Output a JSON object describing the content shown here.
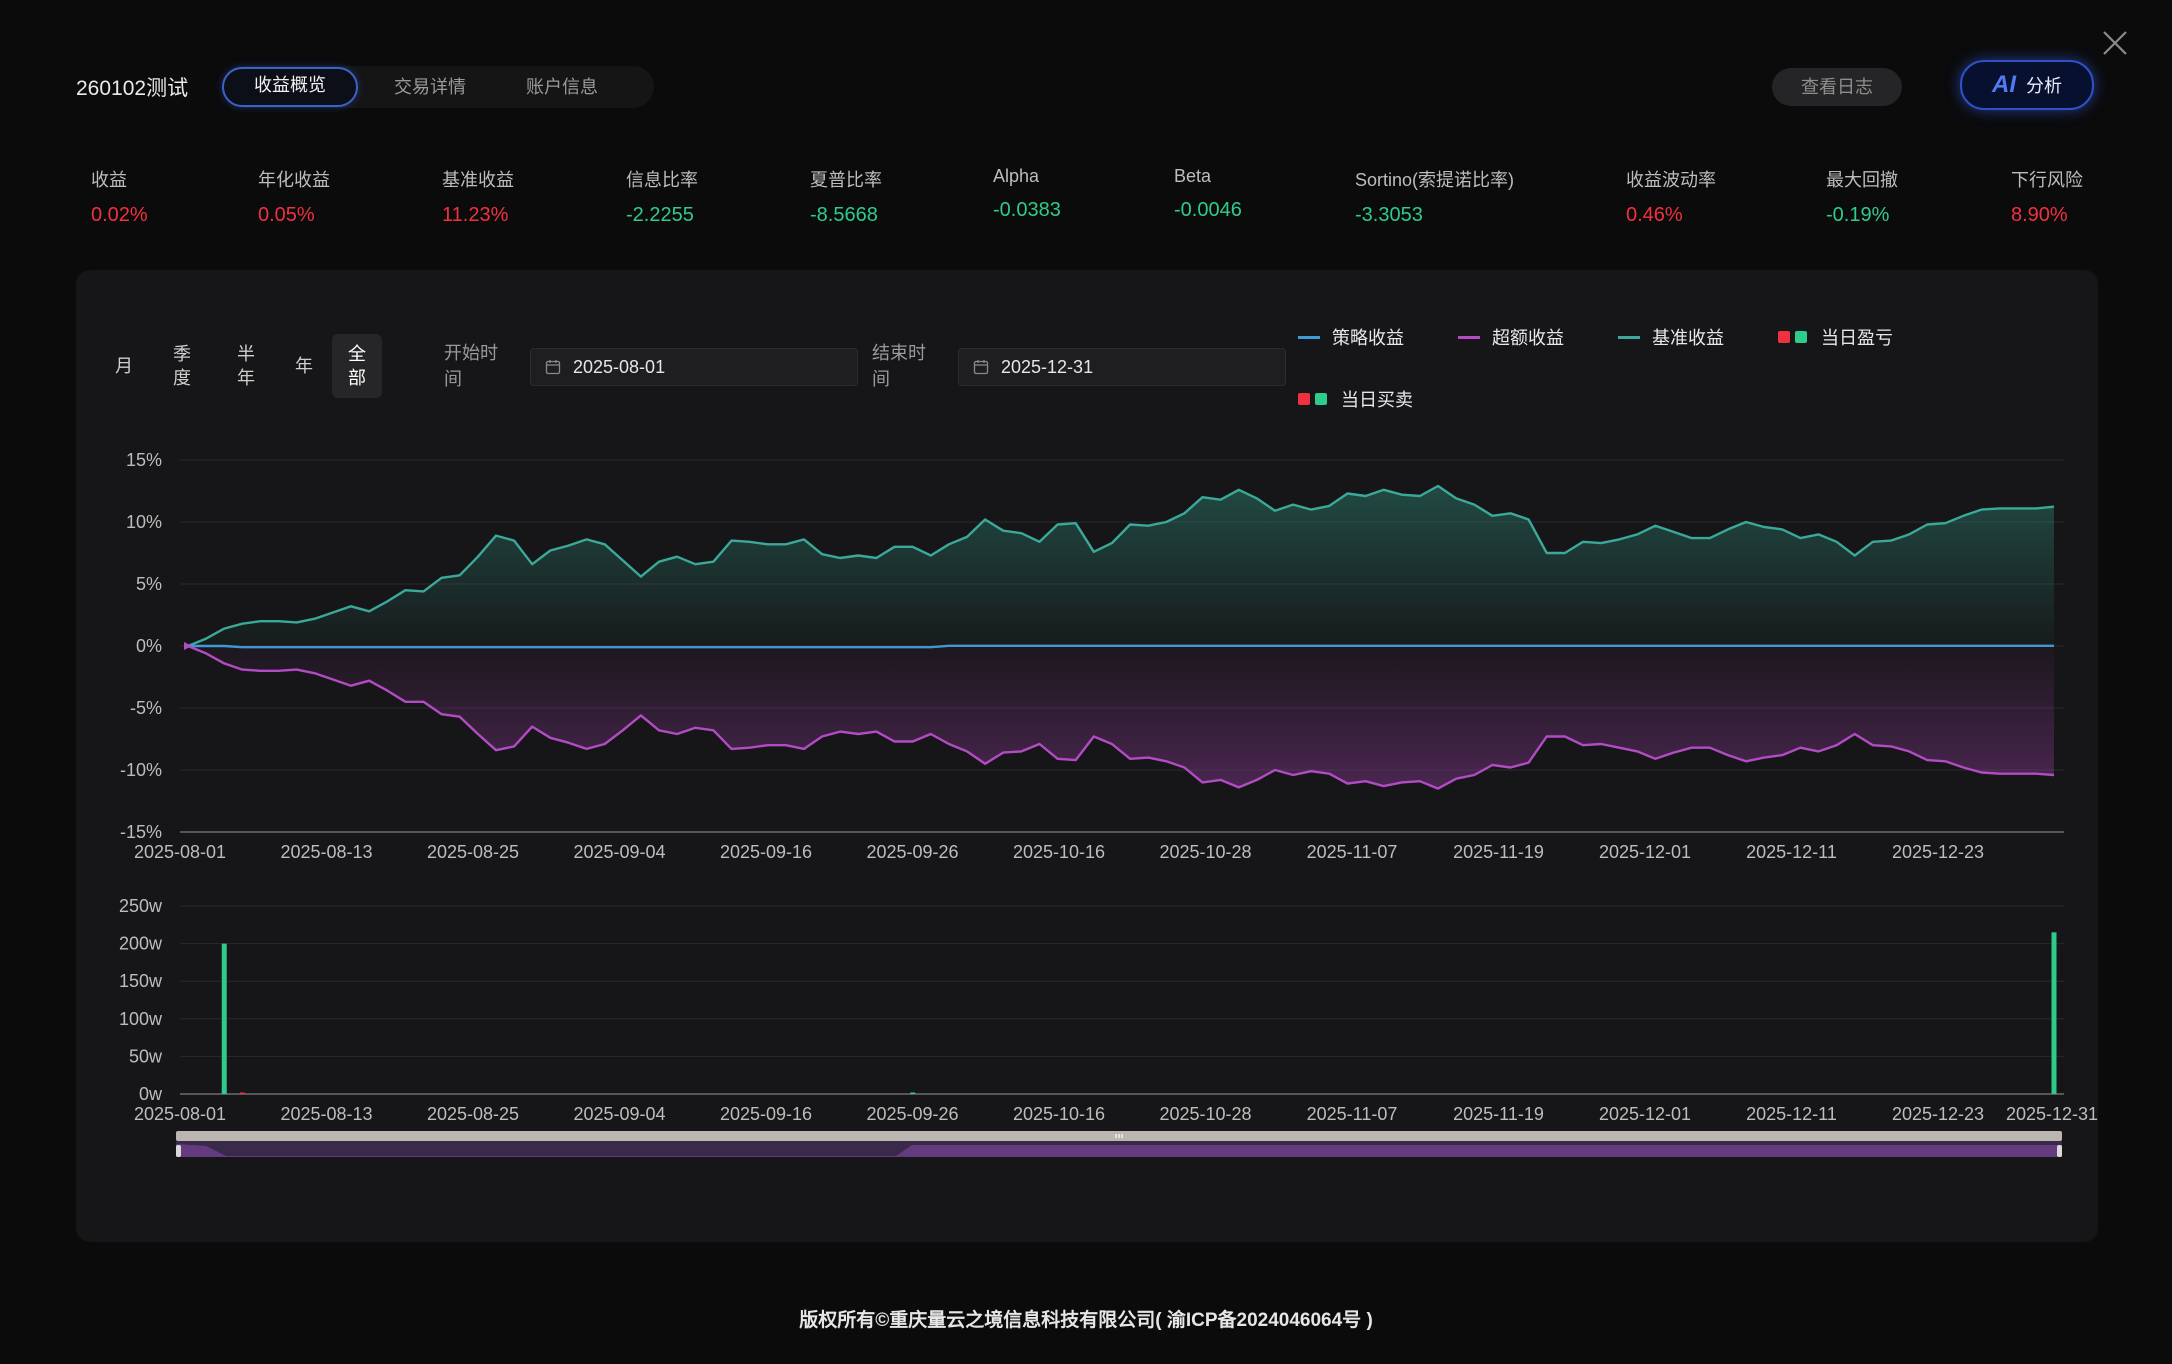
{
  "header": {
    "title": "260102测试",
    "tabs": [
      {
        "label": "收益概览",
        "active": true
      },
      {
        "label": "交易详情",
        "active": false
      },
      {
        "label": "账户信息",
        "active": false
      }
    ],
    "log_button": "查看日志",
    "ai_button": {
      "badge": "AI",
      "label": "分析"
    }
  },
  "metrics": [
    {
      "label": "收益",
      "value": "0.02%",
      "color": "red"
    },
    {
      "label": "年化收益",
      "value": "0.05%",
      "color": "red"
    },
    {
      "label": "基准收益",
      "value": "11.23%",
      "color": "red"
    },
    {
      "label": "信息比率",
      "value": "-2.2255",
      "color": "green"
    },
    {
      "label": "夏普比率",
      "value": "-8.5668",
      "color": "green"
    },
    {
      "label": "Alpha",
      "value": "-0.0383",
      "color": "green"
    },
    {
      "label": "Beta",
      "value": "-0.0046",
      "color": "green"
    },
    {
      "label": "Sortino(索提诺比率)",
      "value": "-3.3053",
      "color": "green"
    },
    {
      "label": "收益波动率",
      "value": "0.46%",
      "color": "red"
    },
    {
      "label": "最大回撤",
      "value": "-0.19%",
      "color": "green"
    },
    {
      "label": "下行风险",
      "value": "8.90%",
      "color": "red"
    }
  ],
  "filters": {
    "periods": [
      {
        "label": "月",
        "active": false
      },
      {
        "label": "季度",
        "active": false
      },
      {
        "label": "半年",
        "active": false
      },
      {
        "label": "年",
        "active": false
      },
      {
        "label": "全部",
        "active": true
      }
    ],
    "start_label": "开始时间",
    "start_value": "2025-08-01",
    "end_label": "结束时间",
    "end_value": "2025-12-31"
  },
  "legend": [
    {
      "name": "策略收益",
      "color": "#3d9bd6",
      "kind": "line"
    },
    {
      "name": "超额收益",
      "color": "#b24bc4",
      "kind": "line"
    },
    {
      "name": "基准收益",
      "color": "#3aa99a",
      "kind": "line"
    },
    {
      "name": "当日盈亏",
      "colors": [
        "#f0313f",
        "#2ecc8b"
      ],
      "kind": "squares"
    },
    {
      "name": "当日买卖",
      "colors": [
        "#f0313f",
        "#2ecc8b"
      ],
      "kind": "squares"
    }
  ],
  "colors": {
    "strategy": "#3d9bd6",
    "excess": "#b24bc4",
    "benchmark": "#3aa99a",
    "buy": "#f0313f",
    "sell": "#2ecc8b",
    "accent": "#2f50c9"
  },
  "chart_data": [
    {
      "type": "line",
      "y_ticks": [
        "15%",
        "10%",
        "5%",
        "0%",
        "-5%",
        "-10%",
        "-15%"
      ],
      "ylim": [
        -15,
        15
      ],
      "x_ticks": [
        "2025-08-01",
        "2025-08-13",
        "2025-08-25",
        "2025-09-04",
        "2025-09-16",
        "2025-09-26",
        "2025-10-16",
        "2025-10-28",
        "2025-11-07",
        "2025-11-19",
        "2025-12-01",
        "2025-12-11",
        "2025-12-23"
      ],
      "series": [
        {
          "name": "基准收益",
          "values": [
            0,
            0.6,
            1.4,
            1.8,
            2.0,
            2.0,
            1.9,
            2.2,
            2.7,
            3.2,
            2.8,
            3.6,
            4.5,
            4.4,
            5.5,
            5.7,
            7.2,
            8.9,
            8.5,
            6.6,
            7.7,
            8.1,
            8.6,
            8.2,
            6.9,
            5.6,
            6.8,
            7.2,
            6.6,
            6.8,
            8.5,
            8.4,
            8.2,
            8.2,
            8.6,
            7.4,
            7.1,
            7.3,
            7.1,
            8.0,
            8.0,
            7.3,
            8.2,
            8.8,
            10.2,
            9.3,
            9.1,
            8.4,
            9.8,
            9.9,
            7.6,
            8.3,
            9.8,
            9.7,
            10.0,
            10.7,
            12.0,
            11.8,
            12.6,
            11.9,
            10.9,
            11.4,
            11.0,
            11.3,
            12.3,
            12.1,
            12.6,
            12.2,
            12.1,
            12.9,
            11.9,
            11.4,
            10.5,
            10.7,
            10.2,
            7.5,
            7.5,
            8.4,
            8.3,
            8.6,
            9.0,
            9.7,
            9.2,
            8.7,
            8.7,
            9.4,
            10.0,
            9.6,
            9.4,
            8.7,
            9.0,
            8.4,
            7.3,
            8.4,
            8.5,
            9.0,
            9.8,
            9.9,
            10.5,
            11.0,
            11.1,
            11.1,
            11.1,
            11.23
          ]
        },
        {
          "name": "策略收益",
          "values": [
            0,
            0.0,
            0.0,
            -0.1,
            -0.1,
            -0.1,
            -0.1,
            -0.1,
            -0.1,
            -0.1,
            -0.1,
            -0.1,
            -0.1,
            -0.1,
            -0.1,
            -0.1,
            -0.1,
            -0.1,
            -0.1,
            -0.1,
            -0.1,
            -0.1,
            -0.1,
            -0.1,
            -0.1,
            -0.1,
            -0.1,
            -0.1,
            -0.1,
            -0.1,
            -0.1,
            -0.1,
            -0.1,
            -0.1,
            -0.1,
            -0.1,
            -0.1,
            -0.1,
            -0.1,
            -0.1,
            -0.1,
            -0.1,
            0.02,
            0.02,
            0.02,
            0.02,
            0.02,
            0.02,
            0.02,
            0.02,
            0.02,
            0.02,
            0.02,
            0.02,
            0.02,
            0.02,
            0.02,
            0.02,
            0.02,
            0.02,
            0.02,
            0.02,
            0.02,
            0.02,
            0.02,
            0.02,
            0.02,
            0.02,
            0.02,
            0.02,
            0.02,
            0.02,
            0.02,
            0.02,
            0.02,
            0.02,
            0.02,
            0.02,
            0.02,
            0.02,
            0.02,
            0.02,
            0.02,
            0.02,
            0.02,
            0.02,
            0.02,
            0.02,
            0.02,
            0.02,
            0.02,
            0.02,
            0.02,
            0.02,
            0.02,
            0.02,
            0.02,
            0.02,
            0.02,
            0.02,
            0.02,
            0.02,
            0.02,
            0.02
          ]
        },
        {
          "name": "超额收益",
          "values": [
            0,
            -0.6,
            -1.4,
            -1.9,
            -2.0,
            -2.0,
            -1.9,
            -2.2,
            -2.7,
            -3.2,
            -2.8,
            -3.6,
            -4.5,
            -4.5,
            -5.5,
            -5.7,
            -7.1,
            -8.4,
            -8.1,
            -6.5,
            -7.4,
            -7.8,
            -8.3,
            -7.9,
            -6.8,
            -5.6,
            -6.8,
            -7.1,
            -6.6,
            -6.8,
            -8.3,
            -8.2,
            -8.0,
            -8.0,
            -8.3,
            -7.3,
            -6.9,
            -7.1,
            -6.9,
            -7.7,
            -7.7,
            -7.1,
            -7.9,
            -8.5,
            -9.5,
            -8.6,
            -8.5,
            -7.9,
            -9.1,
            -9.2,
            -7.3,
            -7.9,
            -9.1,
            -9.0,
            -9.3,
            -9.8,
            -11.0,
            -10.8,
            -11.4,
            -10.8,
            -10.0,
            -10.4,
            -10.1,
            -10.3,
            -11.1,
            -10.9,
            -11.3,
            -11.0,
            -10.9,
            -11.5,
            -10.7,
            -10.4,
            -9.6,
            -9.8,
            -9.4,
            -7.3,
            -7.3,
            -8.0,
            -7.9,
            -8.2,
            -8.5,
            -9.1,
            -8.6,
            -8.2,
            -8.2,
            -8.8,
            -9.3,
            -9.0,
            -8.8,
            -8.2,
            -8.5,
            -8.0,
            -7.1,
            -8.0,
            -8.1,
            -8.5,
            -9.2,
            -9.3,
            -9.8,
            -10.2,
            -10.3,
            -10.3,
            -10.3,
            -10.4
          ]
        }
      ]
    },
    {
      "type": "bar",
      "y_ticks": [
        "250w",
        "200w",
        "150w",
        "100w",
        "50w",
        "0w"
      ],
      "ylim": [
        0,
        250
      ],
      "x_ticks": [
        "2025-08-01",
        "2025-08-13",
        "2025-08-25",
        "2025-09-04",
        "2025-09-16",
        "2025-09-26",
        "2025-10-16",
        "2025-10-28",
        "2025-11-07",
        "2025-11-19",
        "2025-12-01",
        "2025-12-11",
        "2025-12-23",
        "2025-12-31"
      ],
      "bars": [
        {
          "index": 2,
          "value": 200,
          "color": "#2ecc8b"
        },
        {
          "index": 3,
          "value": 2,
          "color": "#f0313f"
        },
        {
          "index": 40,
          "value": 2,
          "color": "#2ecc8b"
        },
        {
          "index": 103,
          "value": 215,
          "color": "#2ecc8b"
        }
      ]
    }
  ],
  "footer": "版权所有©重庆量云之境信息科技有限公司( 渝ICP备2024046064号 )"
}
